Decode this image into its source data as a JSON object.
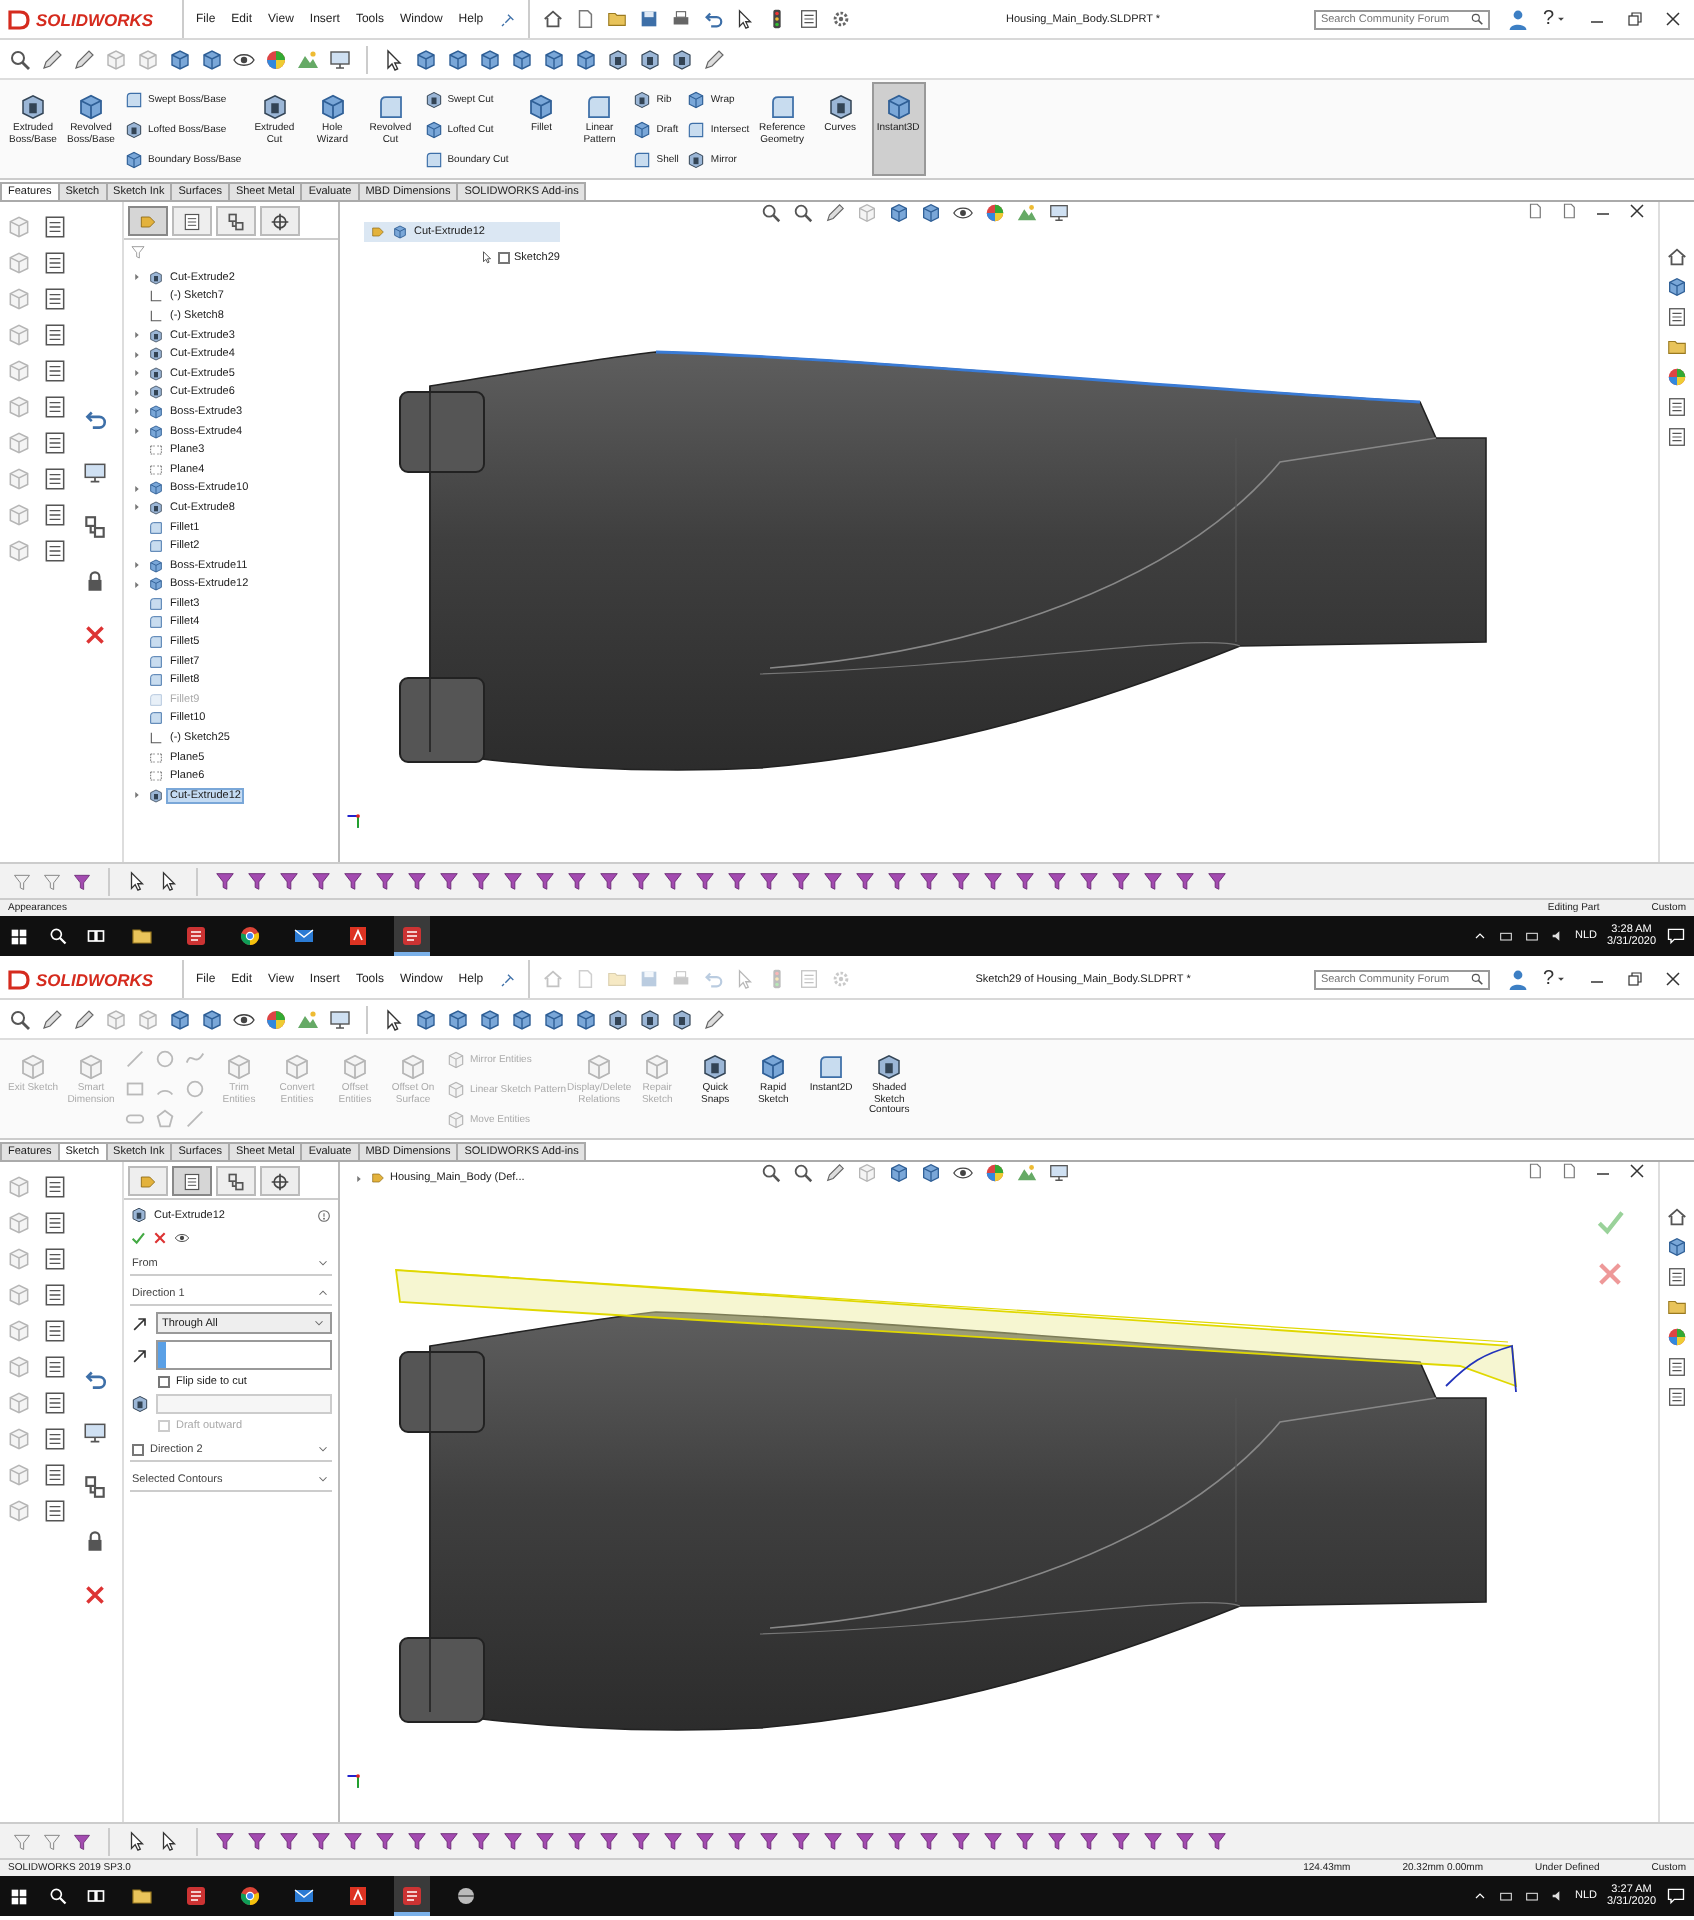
{
  "screens": [
    {
      "logo": "SOLIDWORKS",
      "menu": [
        "File",
        "Edit",
        "View",
        "Insert",
        "Tools",
        "Window",
        "Help"
      ],
      "quick_access_enabled": true,
      "document_title": "Housing_Main_Body.SLDPRT *",
      "search": {
        "placeholder": "Search Community Forum"
      },
      "help": "?",
      "ribbon": [
        {
          "items": [
            {
              "label": "Extruded Boss/Base",
              "disabled": false,
              "on": false
            }
          ]
        },
        {
          "items": [
            {
              "label": "Revolved Boss/Base",
              "disabled": false,
              "on": false
            }
          ]
        },
        {
          "items": [
            {
              "label": "Swept Boss/Base",
              "disabled": false,
              "on": false
            },
            {
              "label": "Lofted Boss/Base",
              "disabled": false,
              "on": false
            },
            {
              "label": "Boundary Boss/Base",
              "disabled": false,
              "on": false
            }
          ]
        },
        {
          "items": [
            {
              "label": "Extruded Cut",
              "disabled": false,
              "on": false
            }
          ]
        },
        {
          "items": [
            {
              "label": "Hole Wizard",
              "disabled": false,
              "on": false
            }
          ]
        },
        {
          "items": [
            {
              "label": "Revolved Cut",
              "disabled": false,
              "on": false
            }
          ]
        },
        {
          "items": [
            {
              "label": "Swept Cut",
              "disabled": false,
              "on": false
            },
            {
              "label": "Lofted Cut",
              "disabled": false,
              "on": false
            },
            {
              "label": "Boundary Cut",
              "disabled": false,
              "on": false
            }
          ]
        },
        {
          "items": [
            {
              "label": "Fillet",
              "disabled": false,
              "on": false
            }
          ]
        },
        {
          "items": [
            {
              "label": "Linear Pattern",
              "disabled": false,
              "on": false
            }
          ]
        },
        {
          "items": [
            {
              "label": "Rib",
              "disabled": false,
              "on": false
            },
            {
              "label": "Draft",
              "disabled": false,
              "on": false
            },
            {
              "label": "Shell",
              "disabled": false,
              "on": false
            }
          ]
        },
        {
          "items": [
            {
              "label": "Wrap",
              "disabled": false,
              "on": false
            },
            {
              "label": "Intersect",
              "disabled": false,
              "on": false
            },
            {
              "label": "Mirror",
              "disabled": false,
              "on": false
            }
          ]
        },
        {
          "items": [
            {
              "label": "Reference Geometry",
              "disabled": false,
              "on": false
            }
          ]
        },
        {
          "items": [
            {
              "label": "Curves",
              "disabled": false,
              "on": false
            }
          ]
        },
        {
          "items": [
            {
              "label": "Instant3D",
              "disabled": false,
              "on": true
            }
          ]
        }
      ],
      "tabs": [
        {
          "label": "Features",
          "selected": true
        },
        {
          "label": "Sketch",
          "selected": false
        },
        {
          "label": "Sketch Ink",
          "selected": false
        },
        {
          "label": "Surfaces",
          "selected": false
        },
        {
          "label": "Sheet Metal",
          "selected": false
        },
        {
          "label": "Evaluate",
          "selected": false
        },
        {
          "label": "MBD Dimensions",
          "selected": false
        },
        {
          "label": "SOLIDWORKS Add-ins",
          "selected": false
        }
      ],
      "panel": {
        "kind": "feature_tree",
        "tabs": [
          {
            "kind": "feature_manager",
            "selected": true
          },
          {
            "kind": "property_manager",
            "selected": false
          },
          {
            "kind": "configuration",
            "selected": false
          },
          {
            "kind": "dimxpert",
            "selected": false
          }
        ],
        "items": [
          {
            "name": "Cut-Extrude2",
            "kind": "cut",
            "suppressed": false,
            "selected": false
          },
          {
            "name": "(-) Sketch7",
            "kind": "sketch",
            "suppressed": false,
            "selected": false
          },
          {
            "name": "(-) Sketch8",
            "kind": "sketch",
            "suppressed": false,
            "selected": false
          },
          {
            "name": "Cut-Extrude3",
            "kind": "cut",
            "suppressed": false,
            "selected": false
          },
          {
            "name": "Cut-Extrude4",
            "kind": "cut",
            "suppressed": false,
            "selected": false
          },
          {
            "name": "Cut-Extrude5",
            "kind": "cut",
            "suppressed": false,
            "selected": false
          },
          {
            "name": "Cut-Extrude6",
            "kind": "cut",
            "suppressed": false,
            "selected": false
          },
          {
            "name": "Boss-Extrude3",
            "kind": "boss",
            "suppressed": false,
            "selected": false
          },
          {
            "name": "Boss-Extrude4",
            "kind": "boss",
            "suppressed": false,
            "selected": false
          },
          {
            "name": "Plane3",
            "kind": "plane",
            "suppressed": false,
            "selected": false
          },
          {
            "name": "Plane4",
            "kind": "plane",
            "suppressed": false,
            "selected": false
          },
          {
            "name": "Boss-Extrude10",
            "kind": "boss",
            "suppressed": false,
            "selected": false
          },
          {
            "name": "Cut-Extrude8",
            "kind": "cut",
            "suppressed": false,
            "selected": false
          },
          {
            "name": "Fillet1",
            "kind": "fillet",
            "suppressed": false,
            "selected": false
          },
          {
            "name": "Fillet2",
            "kind": "fillet",
            "suppressed": false,
            "selected": false
          },
          {
            "name": "Boss-Extrude11",
            "kind": "boss",
            "suppressed": false,
            "selected": false
          },
          {
            "name": "Boss-Extrude12",
            "kind": "boss",
            "suppressed": false,
            "selected": false
          },
          {
            "name": "Fillet3",
            "kind": "fillet",
            "suppressed": false,
            "selected": false
          },
          {
            "name": "Fillet4",
            "kind": "fillet",
            "suppressed": false,
            "selected": false
          },
          {
            "name": "Fillet5",
            "kind": "fillet",
            "suppressed": false,
            "selected": false
          },
          {
            "name": "Fillet7",
            "kind": "fillet",
            "suppressed": false,
            "selected": false
          },
          {
            "name": "Fillet8",
            "kind": "fillet",
            "suppressed": false,
            "selected": false
          },
          {
            "name": "Fillet9",
            "kind": "fillet",
            "suppressed": true,
            "selected": false
          },
          {
            "name": "Fillet10",
            "kind": "fillet",
            "suppressed": false,
            "selected": false
          },
          {
            "name": "(-) Sketch25",
            "kind": "sketch",
            "suppressed": false,
            "selected": false
          },
          {
            "name": "Plane5",
            "kind": "plane",
            "suppressed": false,
            "selected": false
          },
          {
            "name": "Plane6",
            "kind": "plane",
            "suppressed": false,
            "selected": false
          },
          {
            "name": "Cut-Extrude12",
            "kind": "cut",
            "suppressed": false,
            "selected": true
          }
        ]
      },
      "viewport": {
        "edge_highlight": true,
        "cut_preview": false,
        "breadcrumb": {
          "feature": "Cut-Extrude12",
          "sketch": {
            "label": "Sketch29",
            "checked": false
          }
        }
      },
      "status": {
        "left": "Appearances",
        "fields": [
          "Editing Part",
          "Custom"
        ]
      },
      "taskbar": {
        "apps": [
          {
            "kind": "explorer",
            "active": false
          },
          {
            "kind": "solidworks",
            "active": false
          },
          {
            "kind": "chrome",
            "active": false
          },
          {
            "kind": "mail",
            "active": false
          },
          {
            "kind": "pdf",
            "active": false
          },
          {
            "kind": "solidworks",
            "active": true
          }
        ],
        "language": "NLD",
        "time": "3:28 AM",
        "date": "3/31/2020"
      }
    },
    {
      "logo": "SOLIDWORKS",
      "menu": [
        "File",
        "Edit",
        "View",
        "Insert",
        "Tools",
        "Window",
        "Help"
      ],
      "quick_access_enabled": false,
      "document_title": "Sketch29 of Housing_Main_Body.SLDPRT *",
      "search": {
        "placeholder": "Search Community Forum"
      },
      "help": "?",
      "ribbon": [
        {
          "items": [
            {
              "label": "Exit Sketch",
              "disabled": true,
              "on": false
            }
          ]
        },
        {
          "items": [
            {
              "label": "Smart Dimension",
              "disabled": true,
              "on": false
            }
          ]
        },
        {
          "items": [
            {
              "kind": "line",
              "disabled": true,
              "on": false
            },
            {
              "kind": "rectangle",
              "disabled": true,
              "on": false
            },
            {
              "kind": "slot",
              "disabled": true,
              "on": false
            }
          ]
        },
        {
          "items": [
            {
              "kind": "circle",
              "disabled": true,
              "on": false
            },
            {
              "kind": "arc",
              "disabled": true,
              "on": false
            },
            {
              "kind": "polygon",
              "disabled": true,
              "on": false
            }
          ]
        },
        {
          "items": [
            {
              "kind": "spline",
              "disabled": true,
              "on": false
            },
            {
              "kind": "circle",
              "disabled": true,
              "on": false
            },
            {
              "kind": "line",
              "disabled": true,
              "on": false
            }
          ]
        },
        {
          "items": [
            {
              "label": "Trim Entities",
              "disabled": true,
              "on": false
            }
          ]
        },
        {
          "items": [
            {
              "label": "Convert Entities",
              "disabled": true,
              "on": false
            }
          ]
        },
        {
          "items": [
            {
              "label": "Offset Entities",
              "disabled": true,
              "on": false
            }
          ]
        },
        {
          "items": [
            {
              "label": "Offset On Surface",
              "disabled": true,
              "on": false
            }
          ]
        },
        {
          "items": [
            {
              "label": "Mirror Entities",
              "disabled": true,
              "on": false
            },
            {
              "label": "Linear Sketch Pattern",
              "disabled": true,
              "on": false
            },
            {
              "label": "Move Entities",
              "disabled": true,
              "on": false
            }
          ]
        },
        {
          "items": [
            {
              "label": "Display/Delete Relations",
              "disabled": true,
              "on": false
            }
          ]
        },
        {
          "items": [
            {
              "label": "Repair Sketch",
              "disabled": true,
              "on": false
            }
          ]
        },
        {
          "items": [
            {
              "label": "Quick Snaps",
              "disabled": false,
              "on": false
            }
          ]
        },
        {
          "items": [
            {
              "label": "Rapid Sketch",
              "disabled": false,
              "on": false
            }
          ]
        },
        {
          "items": [
            {
              "label": "Instant2D",
              "disabled": false,
              "on": false
            }
          ]
        },
        {
          "items": [
            {
              "label": "Shaded Sketch Contours",
              "disabled": false,
              "on": false
            }
          ]
        }
      ],
      "tabs": [
        {
          "label": "Features",
          "selected": false
        },
        {
          "label": "Sketch",
          "selected": true
        },
        {
          "label": "Sketch Ink",
          "selected": false
        },
        {
          "label": "Surfaces",
          "selected": false
        },
        {
          "label": "Sheet Metal",
          "selected": false
        },
        {
          "label": "Evaluate",
          "selected": false
        },
        {
          "label": "MBD Dimensions",
          "selected": false
        },
        {
          "label": "SOLIDWORKS Add-ins",
          "selected": false
        }
      ],
      "panel": {
        "kind": "property_manager",
        "tabs": [
          {
            "kind": "feature_manager",
            "selected": false
          },
          {
            "kind": "property_manager",
            "selected": true
          },
          {
            "kind": "configuration",
            "selected": false
          },
          {
            "kind": "dimxpert",
            "selected": false
          }
        ],
        "title": "Cut-Extrude12",
        "sections": [
          {
            "label": "From",
            "expanded": false
          },
          {
            "label": "Direction 1",
            "expanded": true,
            "end_condition": "Through All",
            "options": [
              {
                "label": "Flip side to cut",
                "checked": false,
                "disabled": false
              },
              {
                "label": "Draft outward",
                "checked": false,
                "disabled": true
              }
            ]
          },
          {
            "label": "Direction 2",
            "expanded": false,
            "checked": false
          },
          {
            "label": "Selected Contours",
            "expanded": false
          }
        ]
      },
      "viewport": {
        "edge_highlight": false,
        "cut_preview": true,
        "tree_flyout": "Housing_Main_Body (Def..."
      },
      "status": {
        "left": "SOLIDWORKS 2019 SP3.0",
        "fields": [
          "124.43mm",
          "20.32mm 0.00mm",
          "Under Defined",
          "Custom"
        ]
      },
      "taskbar": {
        "apps": [
          {
            "kind": "explorer",
            "active": false
          },
          {
            "kind": "solidworks",
            "active": false
          },
          {
            "kind": "chrome",
            "active": false
          },
          {
            "kind": "mail",
            "active": false
          },
          {
            "kind": "pdf",
            "active": false
          },
          {
            "kind": "solidworks",
            "active": true
          },
          {
            "kind": "renderer",
            "active": false
          }
        ],
        "language": "NLD",
        "time": "3:27 AM",
        "date": "3/31/2020"
      }
    }
  ]
}
